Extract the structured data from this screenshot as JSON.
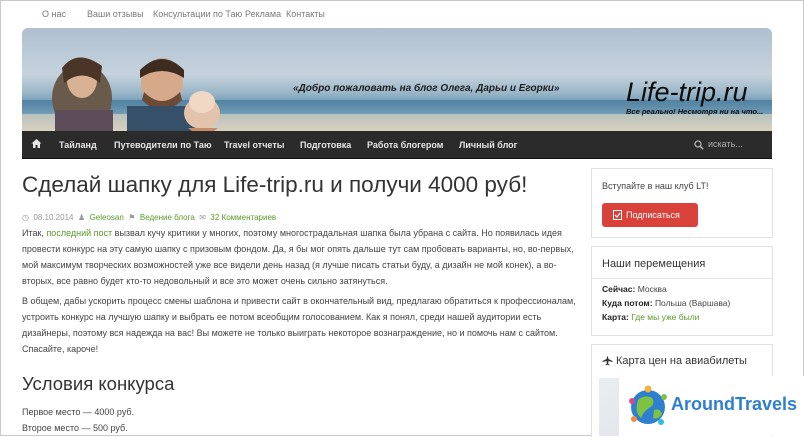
{
  "top_nav": [
    "О нас",
    "Ваши отзывы",
    "Консультации по Таю",
    "Реклама",
    "Контакты"
  ],
  "header": {
    "tagline": "«Добро пожаловать на блог Олега, Дарьи и Егорки»",
    "logo": "Life-trip.ru",
    "logo_sub": "Все реально! Несмотря ни на что..."
  },
  "main_nav": {
    "items": [
      "Тайланд",
      "Путеводители по Таю",
      "Travel отчеты",
      "Подготовка",
      "Работа блогером",
      "Личный блог"
    ],
    "search_placeholder": "искать..."
  },
  "post": {
    "title": "Сделай шапку для Life-trip.ru и получи 4000 руб!",
    "meta": {
      "date": "08.10.2014",
      "author": "Geleosan",
      "category": "Ведение блога",
      "comments": "32 Комментариев"
    },
    "p1_start": "Итак, ",
    "p1_link": "последний пост",
    "p1_rest": " вызвал кучу критики у многих, поэтому многострадальная шапка была убрана с сайта. Но появилась идея провести конкурс на эту самую шапку с призовым фондом. Да, я бы мог опять дальше тут сам пробовать варианты, но, во-первых, мой максимум творческих возможностей уже все видели день назад (я лучше писать статьи буду, а дизайн не мой конек), а во-вторых, все равно будет кто-то недовольный и все это может очень сильно затянуться.",
    "p2": "В общем, дабы ускорить процесс смены шаблона и привести сайт в окончательный вид, предлагаю обратиться к профессионалам, устроить конкурс на лучшую шапку и выбрать ее потом всеобщим голосованием. Как я понял, среди нашей аудитории есть дизайнеры, поэтому вся надежда на вас! Вы можете не только выиграть некоторое вознаграждение, но и помочь нам с сайтом. Спасайте, кароче!",
    "subheading": "Условия конкурса",
    "places": [
      "Первое место — 4000 руб.",
      "Второе место — 500 руб."
    ]
  },
  "sidebar": {
    "club_text": "Вступайте в наш клуб LT!",
    "subscribe_button": "Подписаться",
    "moves_title": "Наши перемещения",
    "now_label": "Сейчас:",
    "now_value": "Москва",
    "next_label": "Куда потом:",
    "next_value": "Польша (Варшава)",
    "map_label": "Карта:",
    "map_link": "Где мы уже были",
    "prices_title": "Карта цен на авиабилеты"
  },
  "watermark": "AroundTravels",
  "colors": {
    "accent_green": "#5a9a2a",
    "nav_dark": "#2b2b2b",
    "subscribe_red": "#d9413b"
  }
}
